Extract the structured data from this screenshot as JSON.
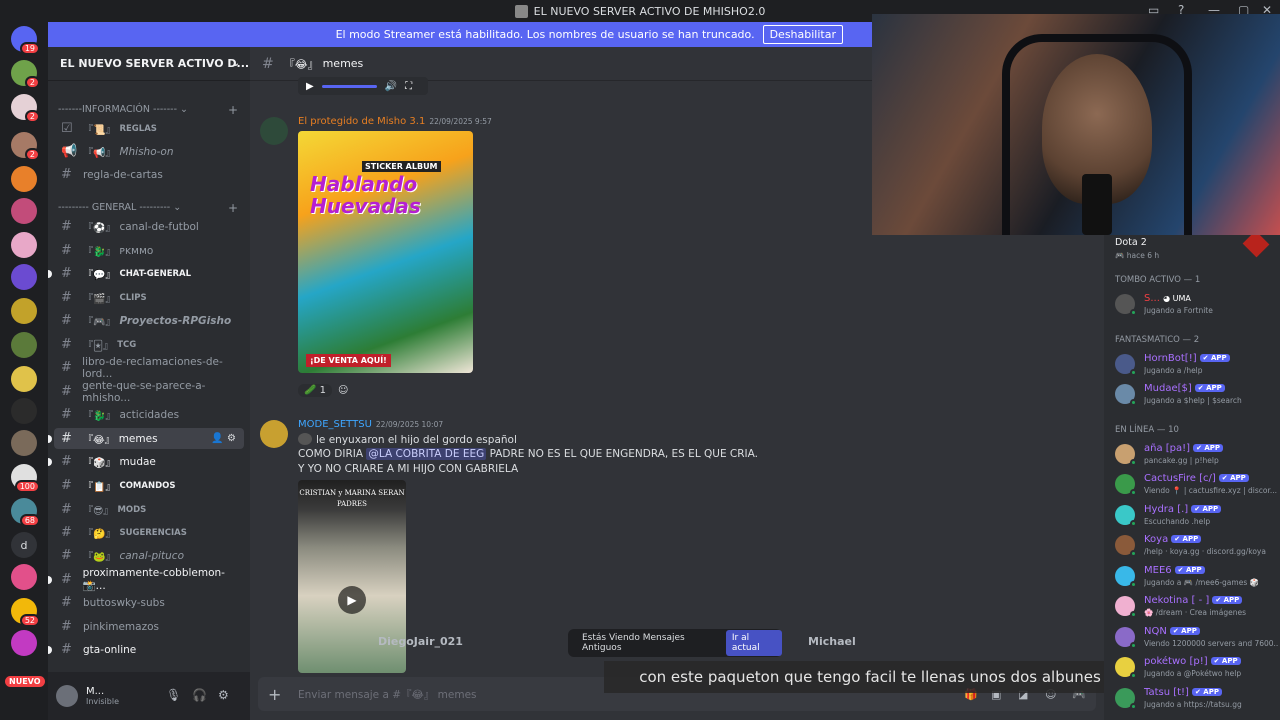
{
  "window": {
    "title": "EL NUEVO SERVER ACTIVO DE MHISHO2.0"
  },
  "streamer": {
    "message": "El modo Streamer está habilitado. Los nombres de usuario se han truncado.",
    "button": "Deshabilitar"
  },
  "rail": {
    "badges": [
      "19",
      "2",
      "2",
      "2",
      "100",
      "68",
      "52"
    ],
    "letter": "d",
    "nuevo": "NUEVO"
  },
  "server": {
    "name": "EL NUEVO SERVER ACTIVO D..."
  },
  "categories": {
    "info": "-------INFORMACIÓN -------",
    "general": "--------- GENERAL ---------"
  },
  "channels": [
    {
      "label": "REGLAS",
      "tag": "『📜』"
    },
    {
      "label": "Mhisho-on",
      "tag": "『📢』"
    },
    {
      "label": "regla-de-cartas"
    },
    {
      "label": "canal-de-futbol",
      "tag": "『⚽』"
    },
    {
      "label": "ᴘᴋᴍᴍᴏ",
      "tag": "『🐉』"
    },
    {
      "label": "CHAT-GENERAL",
      "tag": "『💬』"
    },
    {
      "label": "CLIPS",
      "tag": "『🎬』"
    },
    {
      "label": "Proyectos-RPGisho",
      "tag": "『🎮』"
    },
    {
      "label": "TCG",
      "tag": "『🃏』"
    },
    {
      "label": "libro-de-reclamaciones-de-lord..."
    },
    {
      "label": "gente-que-se-parece-a-mhisho..."
    },
    {
      "label": "acticidades",
      "tag": "『🐉』"
    },
    {
      "label": "memes",
      "tag": "『😂』"
    },
    {
      "label": "mudae",
      "tag": "『🎲』"
    },
    {
      "label": "COMANDOS",
      "tag": "『📋』"
    },
    {
      "label": "MODS",
      "tag": "『😎』"
    },
    {
      "label": "SUGERENCIAS",
      "tag": "『🤔』"
    },
    {
      "label": "canal-pituco",
      "tag": "『🐸』"
    },
    {
      "label": "proximamente-cobblemon-📸..."
    },
    {
      "label": "buttoswky-subs"
    },
    {
      "label": "pinkimemazos"
    },
    {
      "label": "gta-online"
    }
  ],
  "user": {
    "name": "M...",
    "status": "Invisible"
  },
  "chat": {
    "channel_tag": "『😂』",
    "channel": "memes",
    "msg1": {
      "author": "El protegido de Misho 3.1",
      "time": "22/09/2025 9:57",
      "sticker": {
        "label": "STICKER ALBUM",
        "title": "Hablando Huevadas",
        "footer": "¡DE VENTA AQUÍ!"
      },
      "reaction_count": "1"
    },
    "msg2": {
      "author": "MODE_SETTSU",
      "time": "22/09/2025 10:07",
      "reply": "le enyuxaron el hijo del gordo español",
      "line1_pre": "COMO DIRIA ",
      "mention": "@LA COBRITA DE EEG",
      "line1_post": " PADRE NO ES EL QUE ENGENDRA, ES EL QUE CRIA.",
      "line2": "Y YO NO CRIARE A MI HIJO CON GABRIELA",
      "video_caption": "CRISTIAN y MARINA SERAN PADRES"
    },
    "old_messages": "Estás Viendo Mensajes Antiguos",
    "jump": "Ir al actual",
    "ghost_left": "DiegoJair_021",
    "ghost_right": "Michael",
    "subtitle": "con este paqueton que tengo facil te llenas unos dos albunes",
    "composer_placeholder": "Enviar mensaje a #『😂』 memes"
  },
  "activity": {
    "game": "Dota 2",
    "ago": "hace 6 h"
  },
  "members": {
    "sections": [
      "TOMBO ACTIVO — 1",
      "fantasmatico — 2",
      "En línea — 10"
    ],
    "list": [
      {
        "name": "S...",
        "extra": "UMA",
        "activity": "Jugando a Fortnite",
        "color": "#f23f43"
      },
      {
        "name": "HornBot[!]",
        "app": "APP",
        "activity": "Jugando a /help",
        "color": "#a970ff"
      },
      {
        "name": "Mudae[$]",
        "app": "APP",
        "activity": "Jugando a $help | $search",
        "color": "#a970ff"
      },
      {
        "name": "aña [pa!]",
        "app": "APP",
        "activity": "pancake.gg | p!help",
        "color": "#a970ff"
      },
      {
        "name": "CactusFire [c/]",
        "app": "APP",
        "activity": "Viendo 📍 | cactusfire.xyz | discor...",
        "color": "#a970ff"
      },
      {
        "name": "Hydra [.]",
        "app": "APP",
        "activity": "Escuchando .help",
        "color": "#a970ff"
      },
      {
        "name": "Koya",
        "app": "APP",
        "activity": "/help · koya.gg · discord.gg/koya",
        "color": "#a970ff"
      },
      {
        "name": "MEE6",
        "app": "APP",
        "activity": "Jugando a 🎮 /mee6-games 🎲",
        "color": "#a970ff"
      },
      {
        "name": "Nekotina [ - ]",
        "app": "APP",
        "activity": "🌸 /dream · Crea imágenes",
        "color": "#a970ff"
      },
      {
        "name": "NQN",
        "app": "APP",
        "activity": "Viendo 1200000 servers and 7600...",
        "color": "#a970ff"
      },
      {
        "name": "pokétwo [p!]",
        "app": "APP",
        "activity": "Jugando a @Pokétwo help",
        "color": "#a970ff"
      },
      {
        "name": "Tatsu [t!]",
        "app": "APP",
        "activity": "Jugando a https://tatsu.gg",
        "color": "#a970ff"
      }
    ]
  }
}
